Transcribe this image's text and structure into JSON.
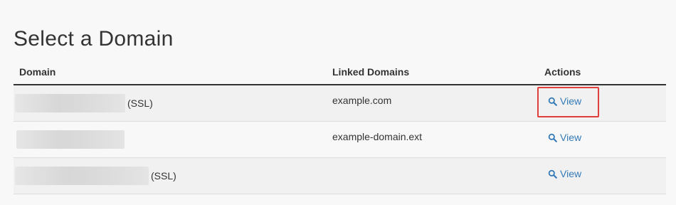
{
  "page": {
    "title": "Select a Domain"
  },
  "table": {
    "headers": {
      "domain": "Domain",
      "linked_domains": "Linked Domains",
      "actions": "Actions"
    },
    "rows": [
      {
        "domain": "",
        "ssl": "(SSL)",
        "linked_domain": "example.com",
        "action_label": "View",
        "highlighted": true
      },
      {
        "domain": "",
        "ssl": "",
        "linked_domain": "example-domain.ext",
        "action_label": "View",
        "highlighted": false
      },
      {
        "domain": "",
        "ssl": "(SSL)",
        "linked_domain": "",
        "action_label": "View",
        "highlighted": false
      }
    ]
  },
  "icons": {
    "view": "search-icon"
  },
  "colors": {
    "link": "#337ab7",
    "highlight": "#e0403d",
    "header_border": "#333333",
    "row_striped": "#f1f1f1",
    "page_bg": "#f8f8f8"
  }
}
